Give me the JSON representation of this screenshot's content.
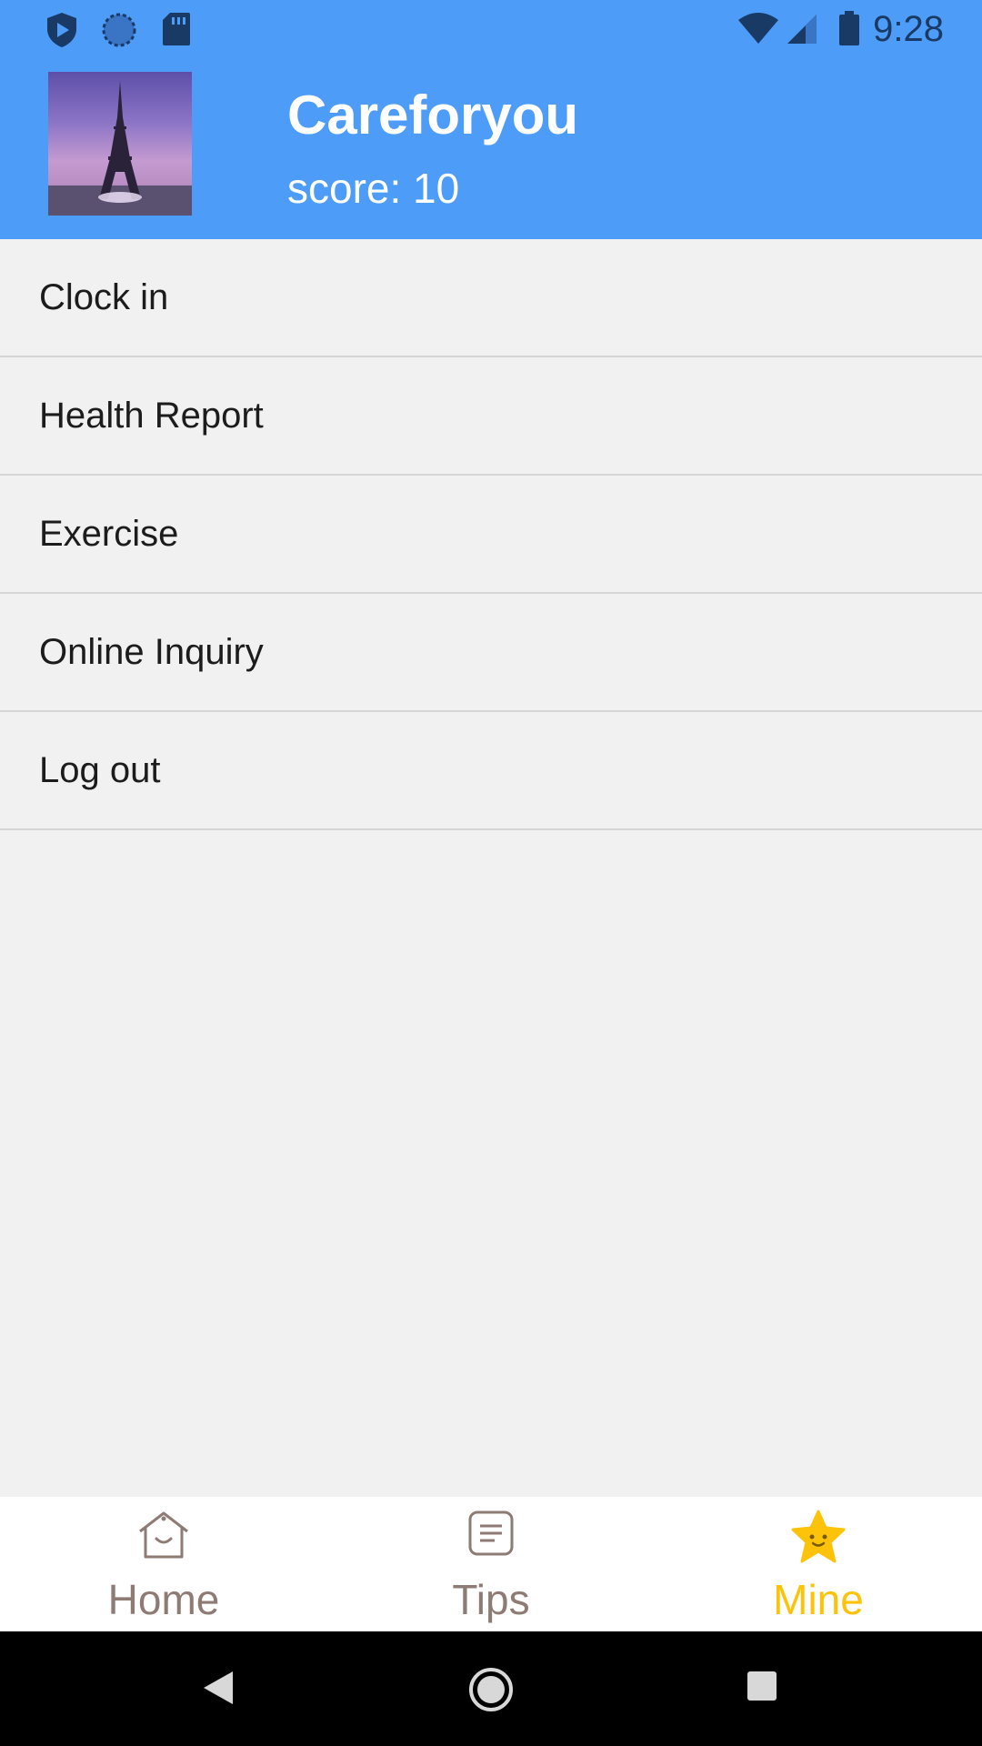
{
  "status_bar": {
    "time": "9:28",
    "icons": [
      "play-protect-icon",
      "sync-icon",
      "sd-card-icon",
      "wifi-icon",
      "signal-icon",
      "battery-icon"
    ]
  },
  "header": {
    "app_name": "Careforyou",
    "score": "score: 10",
    "background_color": "#4d9cf8"
  },
  "menu": {
    "items": [
      {
        "label": "Clock in"
      },
      {
        "label": "Health Report"
      },
      {
        "label": "Exercise"
      },
      {
        "label": "Online Inquiry"
      },
      {
        "label": "Log out"
      }
    ]
  },
  "tabbar": {
    "tabs": [
      {
        "label": "Home",
        "icon": "home-icon"
      },
      {
        "label": "Tips",
        "icon": "tips-icon"
      },
      {
        "label": "Mine",
        "icon": "star-icon",
        "active": true
      }
    ],
    "active_color": "#fdc30a",
    "inactive_color": "#8d7b74"
  },
  "nav_bar": {
    "buttons": [
      "back-icon",
      "home-circle-icon",
      "recents-icon"
    ]
  }
}
